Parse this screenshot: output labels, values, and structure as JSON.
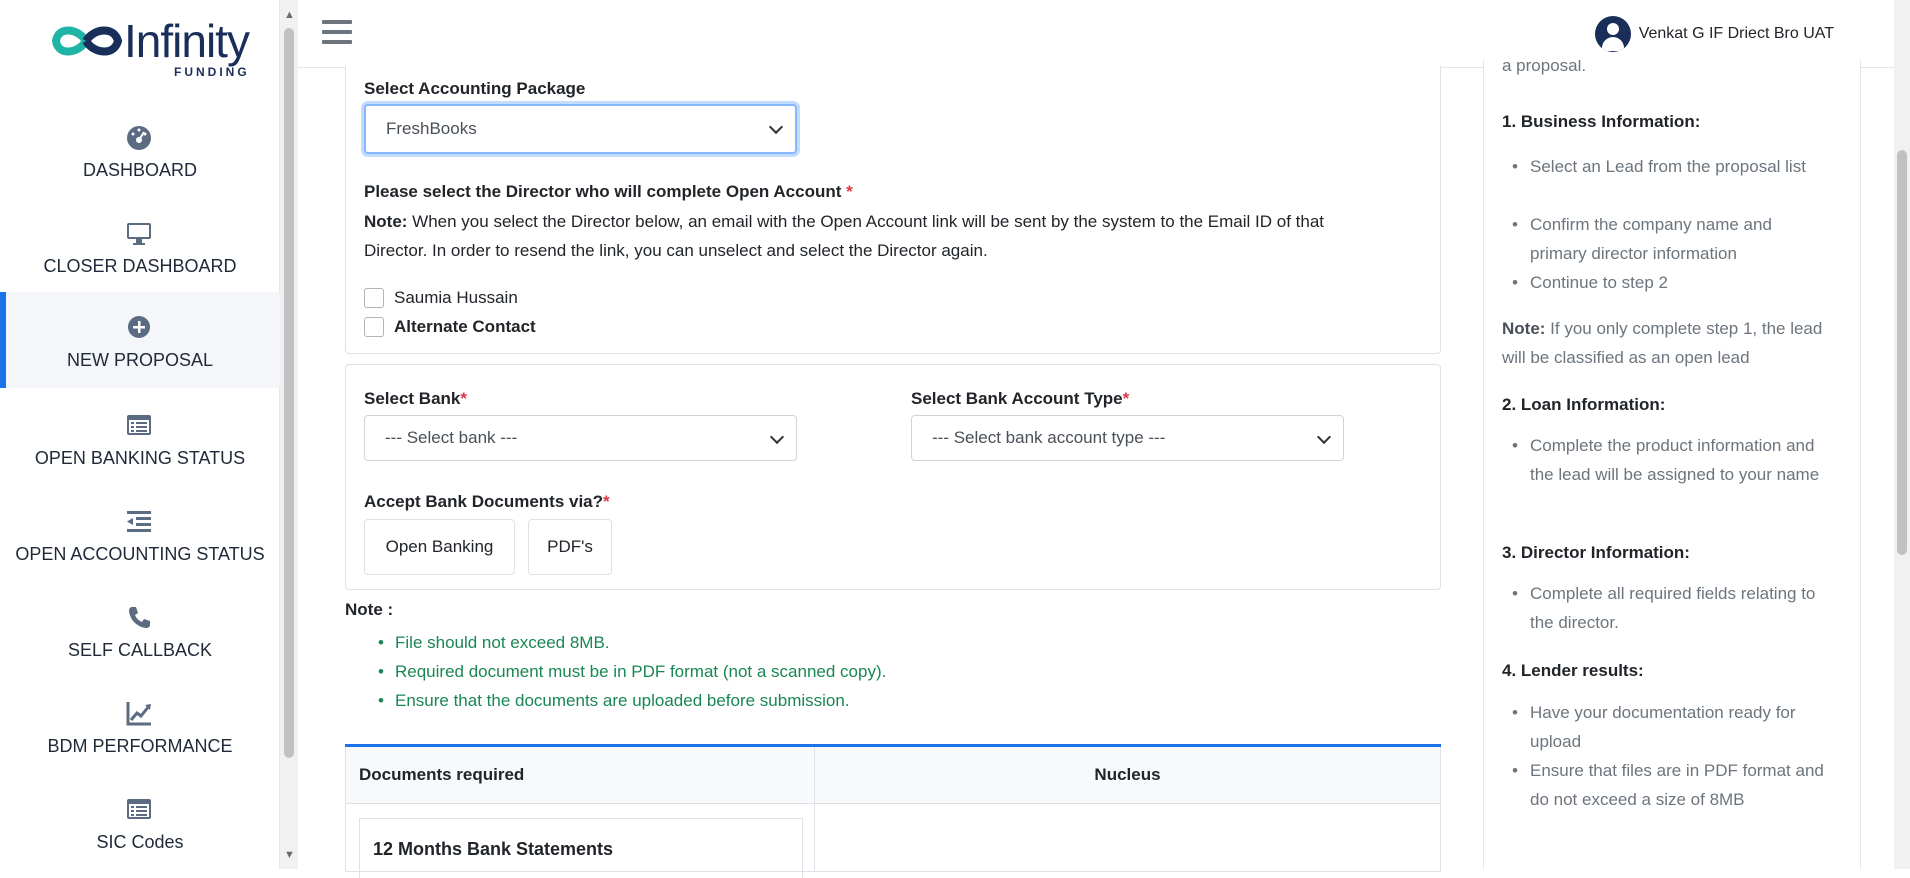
{
  "brand": {
    "name": "Infinity",
    "tagline": "FUNDING"
  },
  "sidebar": {
    "items": [
      {
        "label": "DASHBOARD",
        "icon": "dashboard-gauge-icon"
      },
      {
        "label": "CLOSER DASHBOARD",
        "icon": "monitor-icon"
      },
      {
        "label": "NEW PROPOSAL",
        "icon": "plus-circle-icon",
        "active": true
      },
      {
        "label": "OPEN BANKING STATUS",
        "icon": "list-card-icon"
      },
      {
        "label": "OPEN ACCOUNTING STATUS",
        "icon": "indent-list-icon"
      },
      {
        "label": "SELF CALLBACK",
        "icon": "phone-icon"
      },
      {
        "label": "BDM PERFORMANCE",
        "icon": "chart-line-icon"
      },
      {
        "label": "SIC Codes",
        "icon": "list-card-icon"
      }
    ]
  },
  "header": {
    "user_name": "Venkat G IF Driect Bro UAT"
  },
  "accounting": {
    "label": "Select Accounting Package",
    "selected": "FreshBooks"
  },
  "director": {
    "question": "Please select the Director who will complete Open Account",
    "required_mark": "*",
    "note_label": "Note:",
    "note_line1": " When you select the Director below, an email with the Open Account link will be sent by the system to the Email ID of that",
    "note_line2": "Director. In order to resend the link, you can unselect and select the Director again.",
    "options": [
      "Saumia Hussain",
      "Alternate Contact"
    ]
  },
  "bank": {
    "bank_label": "Select Bank",
    "bank_placeholder": "--- Select bank ---",
    "type_label": "Select Bank Account Type",
    "type_placeholder": "--- Select bank account type ---",
    "accept_label": "Accept Bank Documents via?",
    "required_mark": "*",
    "buttons": [
      "Open Banking",
      "PDF's"
    ]
  },
  "notes": {
    "title": "Note :",
    "items": [
      "File should not exceed 8MB.",
      "Required document must be in PDF format (not a scanned copy).",
      "Ensure that the documents are uploaded before submission."
    ],
    "color": "#198754"
  },
  "documents": {
    "col1": "Documents required",
    "col2": "Nucleus",
    "first_item": "12 Months Bank Statements"
  },
  "help": {
    "intro_fragment": "a proposal.",
    "sections": [
      {
        "title": "1. Business Information:",
        "bullets": [
          "Select an Lead from the proposal list",
          "Confirm the company name and primary director information",
          "Continue to step 2"
        ]
      },
      {
        "title": "2. Loan Information:",
        "bullets": [
          "Complete the product information and the lead will be assigned to your name"
        ]
      },
      {
        "title": "3. Director Information:",
        "bullets": [
          "Complete all required fields relating to the director."
        ]
      },
      {
        "title": "4. Lender results:",
        "bullets": [
          "Have your documentation ready for upload",
          "Ensure that files are in PDF format and do not exceed a size of 8MB"
        ]
      }
    ],
    "note_label": "Note:",
    "note_text": " If you only complete step 1, the lead will be classified as an open lead"
  },
  "colors": {
    "accent": "#1a73e8",
    "brand_navy": "#1a2e5a",
    "brand_teal": "#1fb5a6",
    "required": "#dc3545"
  }
}
